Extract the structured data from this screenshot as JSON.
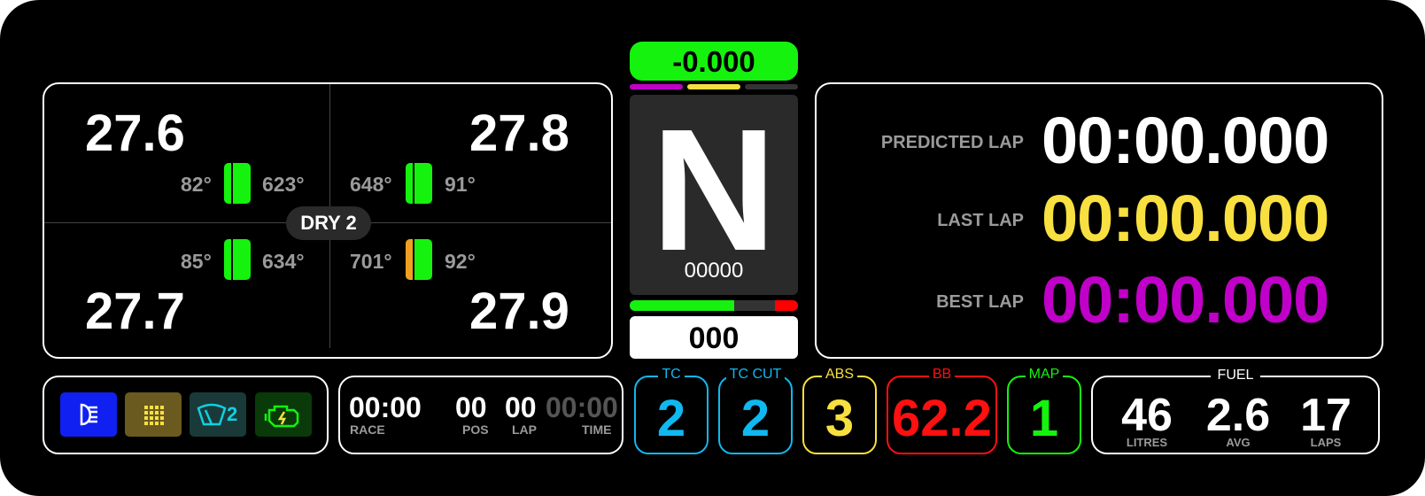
{
  "delta": {
    "value": "-0.000",
    "color": "#15f20e"
  },
  "sector_bars": [
    "#c000c8",
    "#f7e040",
    "#333333"
  ],
  "gear": {
    "value": "N",
    "rpm": "00000"
  },
  "rpm_bar": {
    "green": "#15f20e",
    "red": "#ff0000",
    "fill": 0.62
  },
  "speed": "000",
  "tyres": {
    "compound": "DRY 2",
    "front_left": {
      "pressure": "27.6",
      "temp_inner": "82°",
      "temp_brake": "623°",
      "color": "#15f20e"
    },
    "front_right": {
      "pressure": "27.8",
      "temp_brake": "648°",
      "temp_inner": "91°",
      "color": "#15f20e"
    },
    "rear_left": {
      "pressure": "27.7",
      "temp_inner": "85°",
      "temp_brake": "634°",
      "color": "#15f20e"
    },
    "rear_right": {
      "pressure": "27.9",
      "temp_brake": "701°",
      "temp_inner": "92°",
      "color": "#15f20e",
      "brake_color": "#f0a020"
    }
  },
  "timing": {
    "predicted": {
      "label": "PREDICTED LAP",
      "value": "00:00.000",
      "color": "#ffffff"
    },
    "last": {
      "label": "LAST LAP",
      "value": "00:00.000",
      "color": "#f7e040"
    },
    "best": {
      "label": "BEST LAP",
      "value": "00:00.000",
      "color": "#c000c8"
    }
  },
  "icons": [
    {
      "name": "headlight-icon",
      "bg": "#1020f0"
    },
    {
      "name": "rain-light-icon",
      "bg": "#6a5a20"
    },
    {
      "name": "wiper-icon",
      "bg": "#1a3a3a",
      "text": "2"
    },
    {
      "name": "engine-icon",
      "bg": "#0a3a0a"
    }
  ],
  "race": {
    "race_time": "00:00",
    "race_label": "RACE",
    "pos": "00",
    "pos_label": "POS",
    "lap": "00",
    "lap_label": "LAP",
    "time": "00:00",
    "time_label": "TIME"
  },
  "settings": {
    "tc": {
      "label": "TC",
      "value": "2",
      "color": "#10b8f0"
    },
    "tc_cut": {
      "label": "TC CUT",
      "value": "2",
      "color": "#10b8f0"
    },
    "abs": {
      "label": "ABS",
      "value": "3",
      "color": "#f7e040"
    },
    "bb": {
      "label": "BB",
      "value": "62.2",
      "color": "#ff1010"
    },
    "map": {
      "label": "MAP",
      "value": "1",
      "color": "#15f20e"
    }
  },
  "fuel": {
    "title": "FUEL",
    "litres": "46",
    "litres_label": "LITRES",
    "avg": "2.6",
    "avg_label": "AVG",
    "laps": "17",
    "laps_label": "LAPS"
  }
}
